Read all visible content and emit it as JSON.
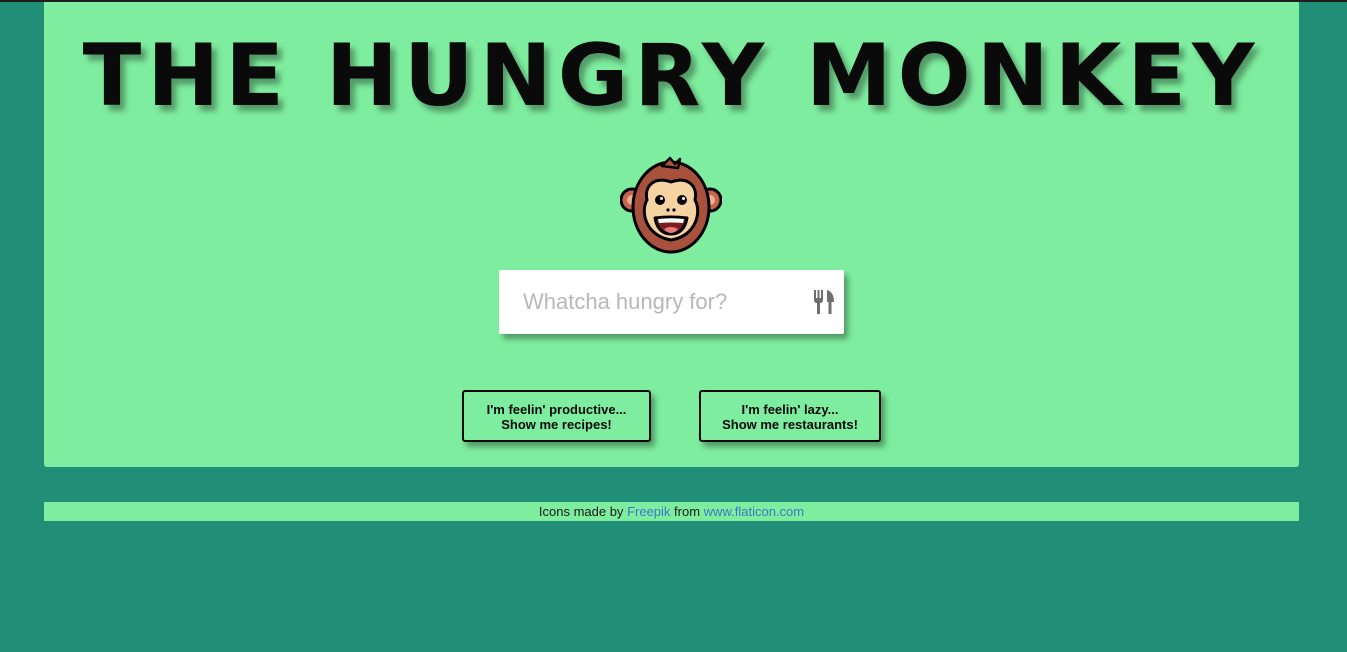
{
  "header": {
    "title": "THE HUNGRY MONKEY"
  },
  "logo": {
    "icon": "monkey-face-icon"
  },
  "search": {
    "placeholder": "Whatcha hungry for?",
    "value": "",
    "icon": "fork-knife-icon"
  },
  "buttons": {
    "recipes": {
      "line1": "I'm feelin' productive...",
      "line2": "Show me recipes!"
    },
    "restaurants": {
      "line1": "I'm feelin' lazy...",
      "line2": "Show me restaurants!"
    }
  },
  "footer": {
    "prefix": "Icons made by",
    "author_link": "Freepik",
    "middle": "from",
    "site_link": "www.flaticon.com"
  },
  "colors": {
    "background": "#218e77",
    "panel": "#7eed9f",
    "link": "#3c79c8",
    "text": "#0a0a0a"
  }
}
